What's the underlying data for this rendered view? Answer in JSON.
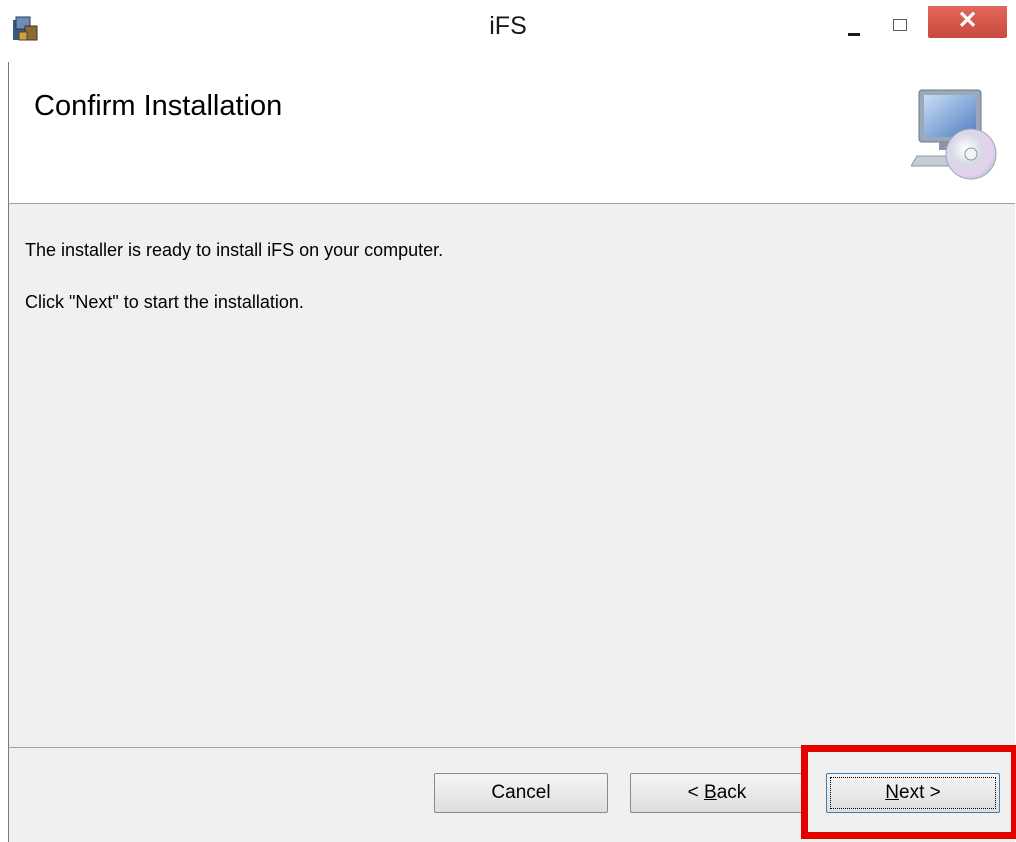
{
  "window": {
    "title": "iFS",
    "controls": {
      "close_glyph": "✕"
    }
  },
  "header": {
    "title": "Confirm Installation",
    "icon": "computer-cd-icon"
  },
  "content": {
    "message1": "The installer is ready to install iFS on your computer.",
    "message2": "Click \"Next\" to start the installation."
  },
  "footer": {
    "cancel_label": "Cancel",
    "back_prefix": "< ",
    "back_mnemonic": "B",
    "back_rest": "ack",
    "next_mnemonic": "N",
    "next_rest": "ext >"
  },
  "colors": {
    "highlight": "#e50000",
    "close_button": "#c94a3f",
    "body_background": "#f0f0f0"
  }
}
